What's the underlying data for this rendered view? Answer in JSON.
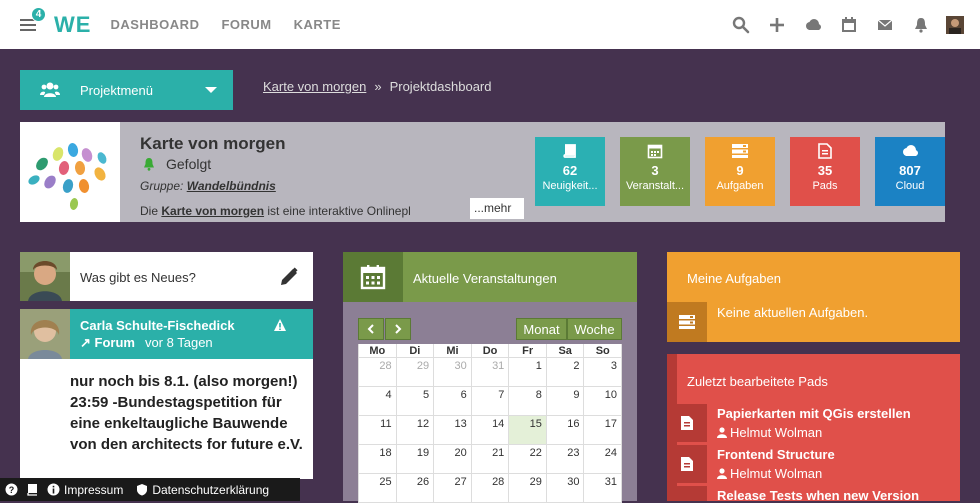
{
  "topbar": {
    "badge_count": "4",
    "logo": "WE",
    "nav": [
      "DASHBOARD",
      "FORUM",
      "KARTE"
    ],
    "icons": [
      "search-icon",
      "plus-icon",
      "cloud-icon",
      "calendar-icon",
      "mail-icon",
      "bell-icon",
      "user-avatar"
    ]
  },
  "project_menu": {
    "label": "Projektmenü"
  },
  "breadcrumb": {
    "parent": "Karte von morgen",
    "separator": "»",
    "current": "Projektdashboard"
  },
  "project": {
    "title": "Karte von morgen",
    "follow_status": "Gefolgt",
    "group_prefix": "Gruppe:",
    "group_name": "Wandelbündnis",
    "desc_prefix": "Die",
    "desc_link": "Karte von morgen",
    "desc_rest": "ist eine interaktive Onlinepl",
    "more": "...mehr"
  },
  "tiles": [
    {
      "value": "62",
      "label": "Neuigkeit...",
      "color": "#2bb0b3",
      "icon": "book-icon"
    },
    {
      "value": "3",
      "label": "Veranstalt...",
      "color": "#7a9a4a",
      "icon": "calendar-icon"
    },
    {
      "value": "9",
      "label": "Aufgaben",
      "color": "#f0a030",
      "icon": "tasks-icon"
    },
    {
      "value": "35",
      "label": "Pads",
      "color": "#e0504a",
      "icon": "document-icon"
    },
    {
      "value": "807",
      "label": "Cloud",
      "color": "#1b82c4",
      "icon": "cloud-icon"
    }
  ],
  "news": {
    "prompt": "Was gibt es Neues?"
  },
  "post": {
    "author": "Carla Schulte-Fischedick",
    "channel": "↗ Forum",
    "time": "vor 8 Tagen",
    "body": "nur noch bis 8.1. (also morgen!) 23:59 -Bundestagspetition für eine enkeltaugliche Bauwende von den architects for future e.V."
  },
  "events": {
    "title": "Aktuelle Veranstaltungen",
    "view_month": "Monat",
    "view_week": "Woche",
    "weekdays": [
      "Mo",
      "Di",
      "Mi",
      "Do",
      "Fr",
      "Sa",
      "So"
    ],
    "weeks": [
      [
        "28",
        "29",
        "30",
        "31",
        "1",
        "2",
        "3"
      ],
      [
        "4",
        "5",
        "6",
        "7",
        "8",
        "9",
        "10"
      ],
      [
        "11",
        "12",
        "13",
        "14",
        "15",
        "16",
        "17"
      ],
      [
        "18",
        "19",
        "20",
        "21",
        "22",
        "23",
        "24"
      ],
      [
        "25",
        "26",
        "27",
        "28",
        "29",
        "30",
        "31"
      ]
    ],
    "today": "15"
  },
  "tasks": {
    "title": "Meine Aufgaben",
    "empty": "Keine aktuellen Aufgaben."
  },
  "pads": {
    "title": "Zuletzt bearbeitete Pads",
    "items": [
      {
        "title": "Papierkarten mit QGis erstellen",
        "user": "Helmut Wolman"
      },
      {
        "title": "Frontend Structure",
        "user": "Helmut Wolman"
      },
      {
        "title": "Release Tests when new Version",
        "user": ""
      }
    ]
  },
  "footer": {
    "impressum": "Impressum",
    "privacy": "Datenschutzerklärung"
  }
}
